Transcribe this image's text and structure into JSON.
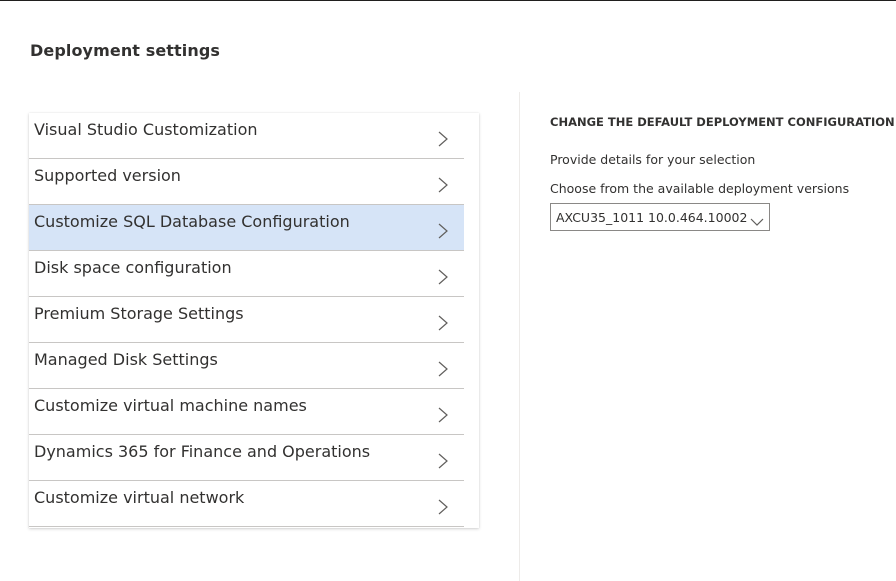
{
  "page": {
    "title": "Deployment settings"
  },
  "nav": {
    "items": [
      {
        "label": "Visual Studio Customization",
        "selected": false
      },
      {
        "label": "Supported version",
        "selected": false
      },
      {
        "label": "Customize SQL Database Configuration",
        "selected": true
      },
      {
        "label": "Disk space configuration",
        "selected": false
      },
      {
        "label": "Premium Storage Settings",
        "selected": false
      },
      {
        "label": "Managed Disk Settings",
        "selected": false
      },
      {
        "label": "Customize virtual machine names",
        "selected": false
      },
      {
        "label": "Dynamics 365 for Finance and Operations",
        "selected": false
      },
      {
        "label": "Customize virtual network",
        "selected": false
      }
    ],
    "item_icon": "chevron-right-icon"
  },
  "detail": {
    "heading": "CHANGE THE DEFAULT DEPLOYMENT CONFIGURATION",
    "helper_text": "Provide details for your selection",
    "version_label": "Choose from the available deployment versions",
    "version_select": {
      "value": "AXCU35_1011 10.0.464.10002",
      "icon": "chevron-down-icon"
    }
  },
  "colors": {
    "selected_background": "#d6e4f7",
    "text": "#323130",
    "divider": "#c8c6c4"
  }
}
